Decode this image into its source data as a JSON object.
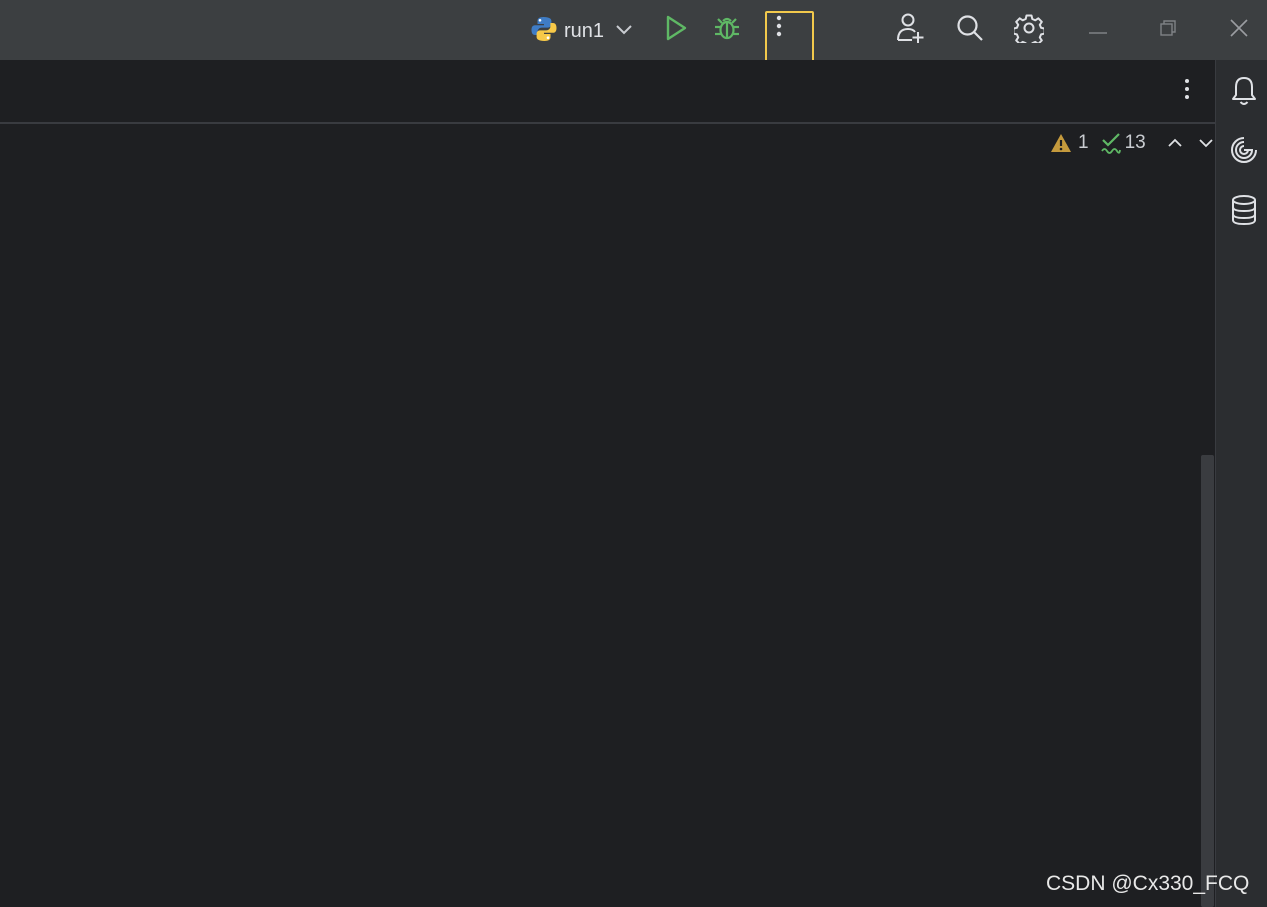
{
  "toolbar": {
    "run_config_label": "run1",
    "run_config_icon": "python-icon",
    "actions": [
      {
        "name": "run",
        "icon": "play-icon"
      },
      {
        "name": "debug",
        "icon": "bug-icon"
      },
      {
        "name": "more-actions",
        "icon": "vertical-dots-icon",
        "highlighted": true
      },
      {
        "name": "code-with-me",
        "icon": "add-user-icon"
      },
      {
        "name": "search-everywhere",
        "icon": "search-icon"
      },
      {
        "name": "settings",
        "icon": "gear-icon"
      }
    ],
    "window_controls": [
      "minimize",
      "restore",
      "close"
    ]
  },
  "editor": {
    "inspection_widget": {
      "warnings_count": "1",
      "weak_warnings_count": "13"
    }
  },
  "right_stripe": {
    "tools": [
      {
        "name": "notifications",
        "icon": "bell-icon"
      },
      {
        "name": "ai-assistant",
        "icon": "spiral-icon"
      },
      {
        "name": "database",
        "icon": "database-icon"
      }
    ]
  },
  "watermark": "CSDN @Cx330_FCQ",
  "colors": {
    "titlebar": "#3c3f41",
    "editor_bg": "#1e1f22",
    "run_green": "#5fb865",
    "highlight": "#f2c94c",
    "warning": "#c59a3d",
    "check_green": "#5fb865"
  }
}
